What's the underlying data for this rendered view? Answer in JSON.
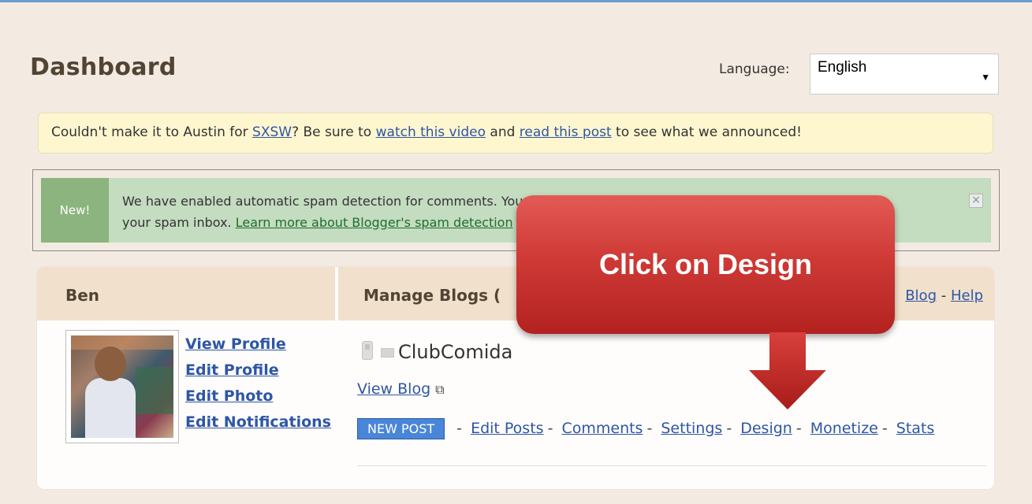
{
  "header": {
    "title": "Dashboard",
    "language_label": "Language:",
    "language_value": "English"
  },
  "notice": {
    "text_1": "Couldn't make it to Austin for ",
    "link_sxsw": "SXSW",
    "text_2": "? Be sure to ",
    "link_video": "watch this video",
    "text_3": " and ",
    "link_post": "read this post",
    "text_4": " to see what we announced!"
  },
  "spam_notice": {
    "badge": "New!",
    "line1": "We have enabled automatic spam detection for comments. You should occasionally check the comments in",
    "line2_prefix": "your spam inbox. ",
    "learn_more": "Learn more about Blogger's spam detection",
    "close": "×"
  },
  "profile": {
    "name": "Ben",
    "links": [
      "View Profile",
      "Edit Profile",
      "Edit Photo",
      "Edit Notifications"
    ]
  },
  "blogs": {
    "header": "Manage Blogs (",
    "header_link_new": "Blog",
    "header_sep": " - ",
    "header_link_help": "Help",
    "blog_name": "ClubComida",
    "view_blog": "View Blog",
    "new_post": "NEW POST",
    "actions": [
      "Edit Posts",
      "Comments",
      "Settings",
      "Design",
      "Monetize",
      "Stats"
    ],
    "action_sep": "-"
  },
  "callout": {
    "text": "Click on Design"
  },
  "icons": {
    "phone": "phone-icon",
    "mail": "mail-icon",
    "external": "external-window-icon",
    "dropdown": "chevron-down-icon",
    "close": "close-icon"
  },
  "colors": {
    "background": "#f3ebe2",
    "link": "#2e56a6",
    "new_post_button": "#4a86d8",
    "callout": "#cf3a36",
    "spam_box": "#c4dcc0",
    "notice": "#fdf6cf"
  }
}
